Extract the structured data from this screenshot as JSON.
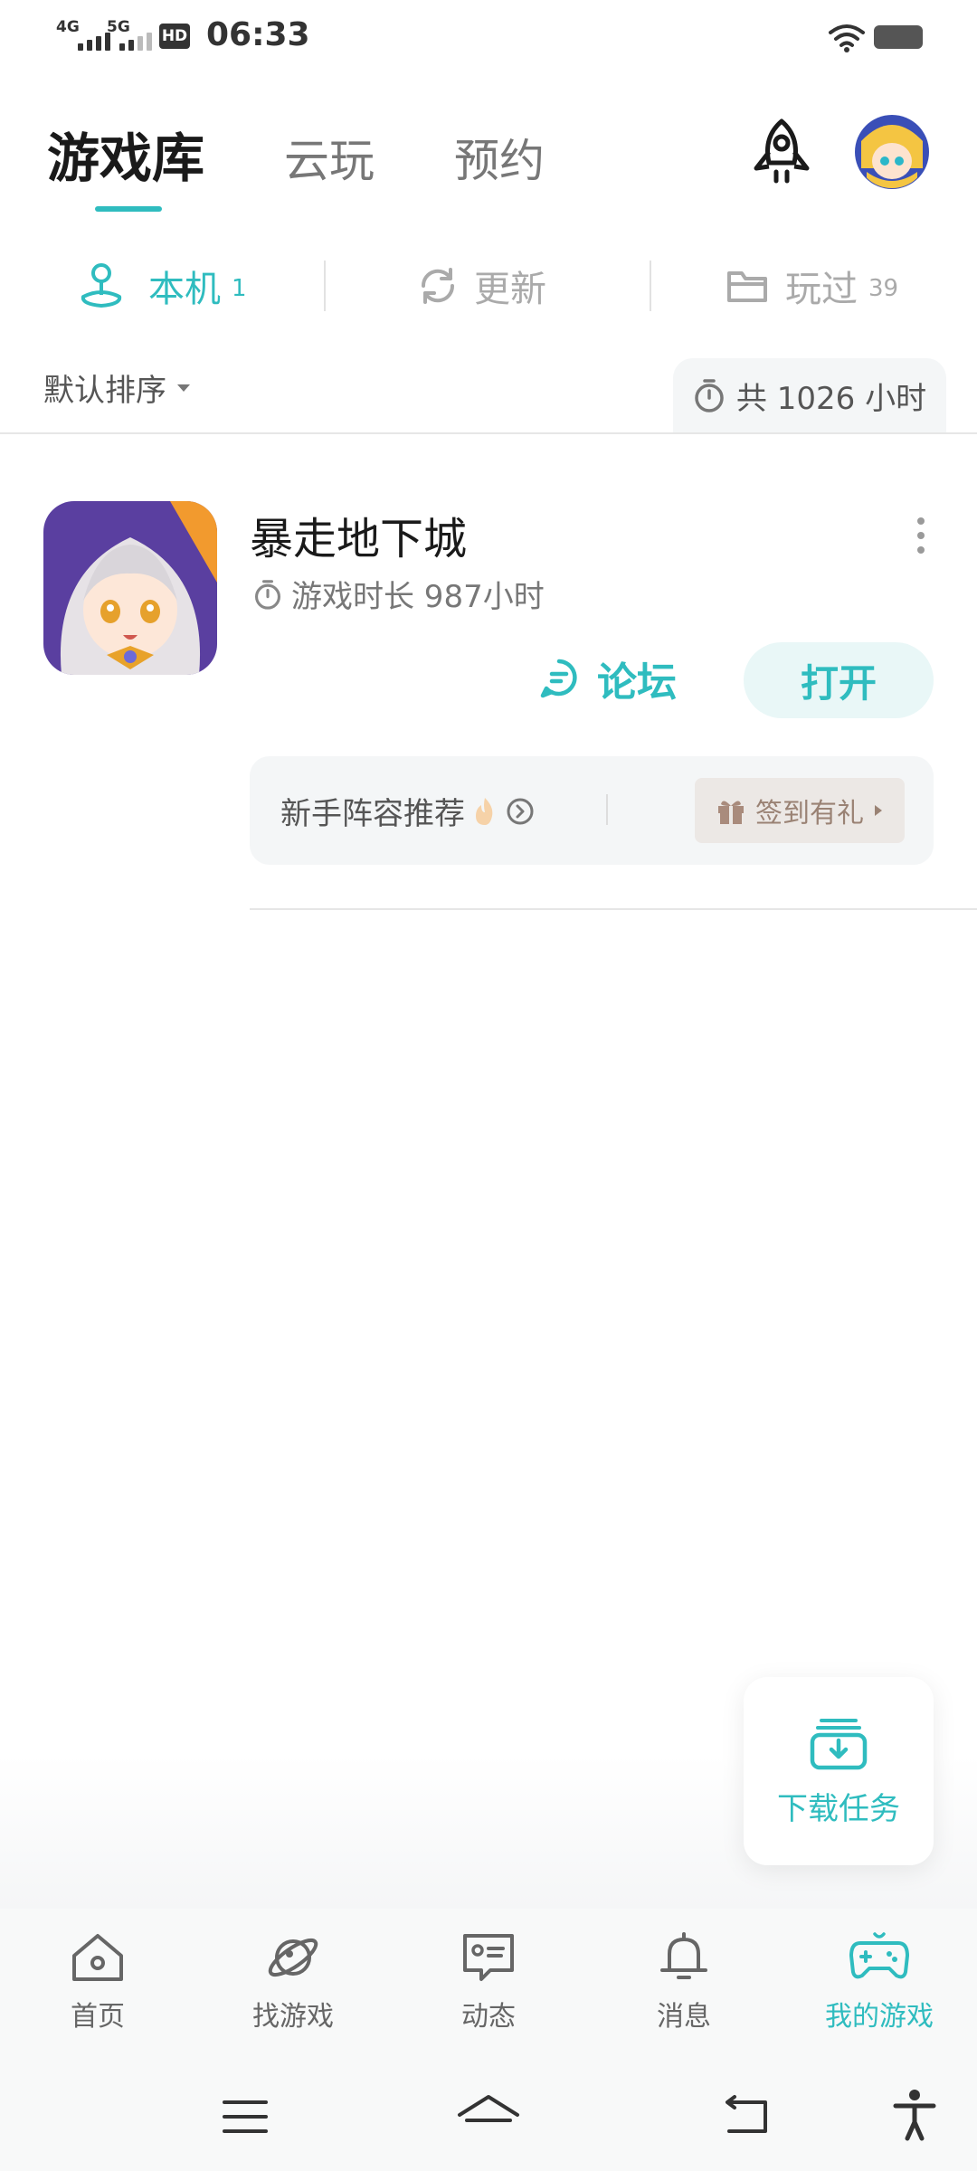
{
  "status_bar": {
    "sim1": "4G",
    "sim2": "5G",
    "hd": "HD",
    "time": "06:33"
  },
  "header": {
    "tabs": [
      {
        "label": "游戏库",
        "active": true
      },
      {
        "label": "云玩",
        "active": false
      },
      {
        "label": "预约",
        "active": false
      }
    ],
    "rocket_icon": "rocket-icon",
    "avatar": "avatar"
  },
  "filters": [
    {
      "label": "本机",
      "count": "1",
      "icon": "joystick-icon",
      "active": true
    },
    {
      "label": "更新",
      "count": "",
      "icon": "refresh-icon",
      "active": false
    },
    {
      "label": "玩过",
      "count": "39",
      "icon": "folder-icon",
      "active": false
    }
  ],
  "sort": {
    "label": "默认排序",
    "total_label": "共 1026 小时"
  },
  "game": {
    "name": "暴走地下城",
    "playtime": "游戏时长 987小时",
    "forum_label": "论坛",
    "open_label": "打开",
    "promo_text": "新手阵容推荐",
    "gift_label": "签到有礼"
  },
  "download_task": {
    "label": "下载任务"
  },
  "bottom_nav": [
    {
      "label": "首页",
      "icon": "home-icon",
      "active": false
    },
    {
      "label": "找游戏",
      "icon": "planet-icon",
      "active": false
    },
    {
      "label": "动态",
      "icon": "message-card-icon",
      "active": false
    },
    {
      "label": "消息",
      "icon": "bell-icon",
      "active": false
    },
    {
      "label": "我的游戏",
      "icon": "gamepad-icon",
      "active": true
    }
  ],
  "colors": {
    "accent": "#2fbcbf",
    "text_primary": "#1a1a1a",
    "text_secondary": "#777777",
    "panel_bg": "#f4f6f7"
  }
}
